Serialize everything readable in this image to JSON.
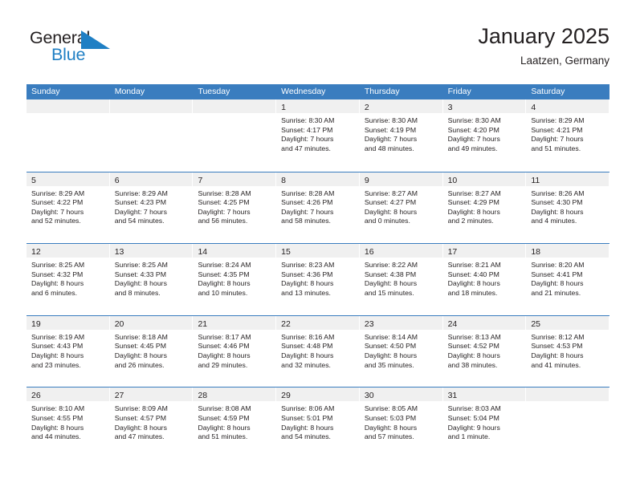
{
  "brand": {
    "name_part1": "General",
    "name_part2": "Blue",
    "accent_color": "#1f7fc4",
    "triangle_icon": "triangle-logo-icon"
  },
  "header": {
    "title": "January 2025",
    "subtitle": "Laatzen, Germany"
  },
  "theme": {
    "header_bar_color": "#3a7dbf",
    "day_band_color": "#f0f0f0",
    "text_color": "#231f20"
  },
  "weekday_headers": [
    "Sunday",
    "Monday",
    "Tuesday",
    "Wednesday",
    "Thursday",
    "Friday",
    "Saturday"
  ],
  "weeks": [
    [
      {
        "day": "",
        "sunrise": "",
        "sunset": "",
        "daylight_line1": "",
        "daylight_line2": ""
      },
      {
        "day": "",
        "sunrise": "",
        "sunset": "",
        "daylight_line1": "",
        "daylight_line2": ""
      },
      {
        "day": "",
        "sunrise": "",
        "sunset": "",
        "daylight_line1": "",
        "daylight_line2": ""
      },
      {
        "day": "1",
        "sunrise": "Sunrise: 8:30 AM",
        "sunset": "Sunset: 4:17 PM",
        "daylight_line1": "Daylight: 7 hours",
        "daylight_line2": "and 47 minutes."
      },
      {
        "day": "2",
        "sunrise": "Sunrise: 8:30 AM",
        "sunset": "Sunset: 4:19 PM",
        "daylight_line1": "Daylight: 7 hours",
        "daylight_line2": "and 48 minutes."
      },
      {
        "day": "3",
        "sunrise": "Sunrise: 8:30 AM",
        "sunset": "Sunset: 4:20 PM",
        "daylight_line1": "Daylight: 7 hours",
        "daylight_line2": "and 49 minutes."
      },
      {
        "day": "4",
        "sunrise": "Sunrise: 8:29 AM",
        "sunset": "Sunset: 4:21 PM",
        "daylight_line1": "Daylight: 7 hours",
        "daylight_line2": "and 51 minutes."
      }
    ],
    [
      {
        "day": "5",
        "sunrise": "Sunrise: 8:29 AM",
        "sunset": "Sunset: 4:22 PM",
        "daylight_line1": "Daylight: 7 hours",
        "daylight_line2": "and 52 minutes."
      },
      {
        "day": "6",
        "sunrise": "Sunrise: 8:29 AM",
        "sunset": "Sunset: 4:23 PM",
        "daylight_line1": "Daylight: 7 hours",
        "daylight_line2": "and 54 minutes."
      },
      {
        "day": "7",
        "sunrise": "Sunrise: 8:28 AM",
        "sunset": "Sunset: 4:25 PM",
        "daylight_line1": "Daylight: 7 hours",
        "daylight_line2": "and 56 minutes."
      },
      {
        "day": "8",
        "sunrise": "Sunrise: 8:28 AM",
        "sunset": "Sunset: 4:26 PM",
        "daylight_line1": "Daylight: 7 hours",
        "daylight_line2": "and 58 minutes."
      },
      {
        "day": "9",
        "sunrise": "Sunrise: 8:27 AM",
        "sunset": "Sunset: 4:27 PM",
        "daylight_line1": "Daylight: 8 hours",
        "daylight_line2": "and 0 minutes."
      },
      {
        "day": "10",
        "sunrise": "Sunrise: 8:27 AM",
        "sunset": "Sunset: 4:29 PM",
        "daylight_line1": "Daylight: 8 hours",
        "daylight_line2": "and 2 minutes."
      },
      {
        "day": "11",
        "sunrise": "Sunrise: 8:26 AM",
        "sunset": "Sunset: 4:30 PM",
        "daylight_line1": "Daylight: 8 hours",
        "daylight_line2": "and 4 minutes."
      }
    ],
    [
      {
        "day": "12",
        "sunrise": "Sunrise: 8:25 AM",
        "sunset": "Sunset: 4:32 PM",
        "daylight_line1": "Daylight: 8 hours",
        "daylight_line2": "and 6 minutes."
      },
      {
        "day": "13",
        "sunrise": "Sunrise: 8:25 AM",
        "sunset": "Sunset: 4:33 PM",
        "daylight_line1": "Daylight: 8 hours",
        "daylight_line2": "and 8 minutes."
      },
      {
        "day": "14",
        "sunrise": "Sunrise: 8:24 AM",
        "sunset": "Sunset: 4:35 PM",
        "daylight_line1": "Daylight: 8 hours",
        "daylight_line2": "and 10 minutes."
      },
      {
        "day": "15",
        "sunrise": "Sunrise: 8:23 AM",
        "sunset": "Sunset: 4:36 PM",
        "daylight_line1": "Daylight: 8 hours",
        "daylight_line2": "and 13 minutes."
      },
      {
        "day": "16",
        "sunrise": "Sunrise: 8:22 AM",
        "sunset": "Sunset: 4:38 PM",
        "daylight_line1": "Daylight: 8 hours",
        "daylight_line2": "and 15 minutes."
      },
      {
        "day": "17",
        "sunrise": "Sunrise: 8:21 AM",
        "sunset": "Sunset: 4:40 PM",
        "daylight_line1": "Daylight: 8 hours",
        "daylight_line2": "and 18 minutes."
      },
      {
        "day": "18",
        "sunrise": "Sunrise: 8:20 AM",
        "sunset": "Sunset: 4:41 PM",
        "daylight_line1": "Daylight: 8 hours",
        "daylight_line2": "and 21 minutes."
      }
    ],
    [
      {
        "day": "19",
        "sunrise": "Sunrise: 8:19 AM",
        "sunset": "Sunset: 4:43 PM",
        "daylight_line1": "Daylight: 8 hours",
        "daylight_line2": "and 23 minutes."
      },
      {
        "day": "20",
        "sunrise": "Sunrise: 8:18 AM",
        "sunset": "Sunset: 4:45 PM",
        "daylight_line1": "Daylight: 8 hours",
        "daylight_line2": "and 26 minutes."
      },
      {
        "day": "21",
        "sunrise": "Sunrise: 8:17 AM",
        "sunset": "Sunset: 4:46 PM",
        "daylight_line1": "Daylight: 8 hours",
        "daylight_line2": "and 29 minutes."
      },
      {
        "day": "22",
        "sunrise": "Sunrise: 8:16 AM",
        "sunset": "Sunset: 4:48 PM",
        "daylight_line1": "Daylight: 8 hours",
        "daylight_line2": "and 32 minutes."
      },
      {
        "day": "23",
        "sunrise": "Sunrise: 8:14 AM",
        "sunset": "Sunset: 4:50 PM",
        "daylight_line1": "Daylight: 8 hours",
        "daylight_line2": "and 35 minutes."
      },
      {
        "day": "24",
        "sunrise": "Sunrise: 8:13 AM",
        "sunset": "Sunset: 4:52 PM",
        "daylight_line1": "Daylight: 8 hours",
        "daylight_line2": "and 38 minutes."
      },
      {
        "day": "25",
        "sunrise": "Sunrise: 8:12 AM",
        "sunset": "Sunset: 4:53 PM",
        "daylight_line1": "Daylight: 8 hours",
        "daylight_line2": "and 41 minutes."
      }
    ],
    [
      {
        "day": "26",
        "sunrise": "Sunrise: 8:10 AM",
        "sunset": "Sunset: 4:55 PM",
        "daylight_line1": "Daylight: 8 hours",
        "daylight_line2": "and 44 minutes."
      },
      {
        "day": "27",
        "sunrise": "Sunrise: 8:09 AM",
        "sunset": "Sunset: 4:57 PM",
        "daylight_line1": "Daylight: 8 hours",
        "daylight_line2": "and 47 minutes."
      },
      {
        "day": "28",
        "sunrise": "Sunrise: 8:08 AM",
        "sunset": "Sunset: 4:59 PM",
        "daylight_line1": "Daylight: 8 hours",
        "daylight_line2": "and 51 minutes."
      },
      {
        "day": "29",
        "sunrise": "Sunrise: 8:06 AM",
        "sunset": "Sunset: 5:01 PM",
        "daylight_line1": "Daylight: 8 hours",
        "daylight_line2": "and 54 minutes."
      },
      {
        "day": "30",
        "sunrise": "Sunrise: 8:05 AM",
        "sunset": "Sunset: 5:03 PM",
        "daylight_line1": "Daylight: 8 hours",
        "daylight_line2": "and 57 minutes."
      },
      {
        "day": "31",
        "sunrise": "Sunrise: 8:03 AM",
        "sunset": "Sunset: 5:04 PM",
        "daylight_line1": "Daylight: 9 hours",
        "daylight_line2": "and 1 minute."
      },
      {
        "day": "",
        "sunrise": "",
        "sunset": "",
        "daylight_line1": "",
        "daylight_line2": ""
      }
    ]
  ]
}
